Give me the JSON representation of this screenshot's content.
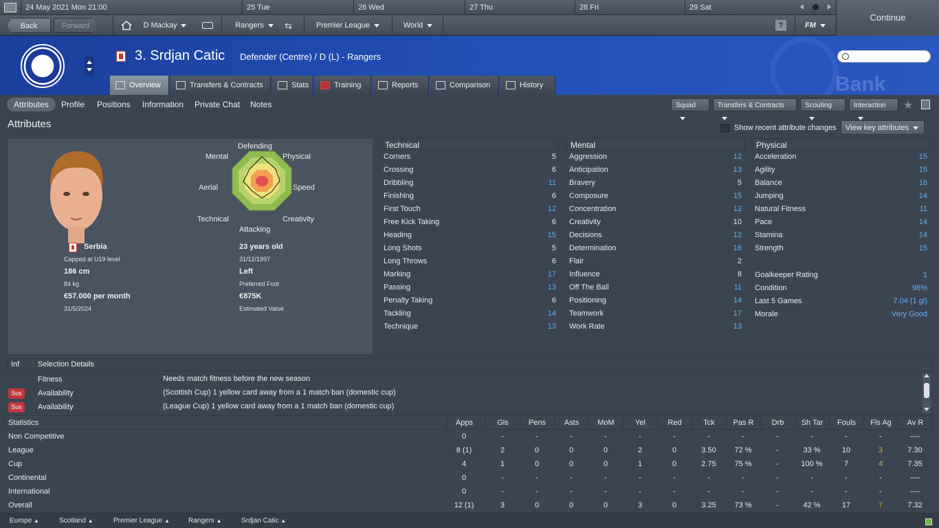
{
  "datebar": {
    "current": "24 May 2021 Mon 21:00",
    "days": [
      "25  Tue",
      "26  Wed",
      "27  Thu",
      "28  Fri",
      "29  Sat"
    ],
    "continue": "Continue"
  },
  "nav": {
    "back": "Back",
    "forward": "Forward",
    "manager": "D Mackay",
    "club": "Rangers",
    "league": "Premier League",
    "world": "World",
    "fm": "FM"
  },
  "player": {
    "title": "3. Srdjan Catic",
    "subtitle": "Defender (Centre) / D (L) - Rangers"
  },
  "tabs": [
    "Overview",
    "Transfers & Contracts",
    "Stats",
    "Training",
    "Reports",
    "Comparison",
    "History"
  ],
  "subtabs": [
    "Attributes",
    "Profile",
    "Positions",
    "Information",
    "Private Chat",
    "Notes"
  ],
  "toolbar": [
    "Squad",
    "Transfers & Contracts",
    "Scouting",
    "Interaction"
  ],
  "attributes_title": "Attributes",
  "show_recent": "Show recent attribute changes",
  "view_key": "View key attributes",
  "radar": {
    "labels": [
      "Defending",
      "Physical",
      "Speed",
      "Creativity",
      "Attacking",
      "Technical",
      "Aerial",
      "Mental"
    ]
  },
  "bio": {
    "nation": "Serbia",
    "caps": "Capped at U19 level",
    "height": "186 cm",
    "weight": "84 kg",
    "wage": "€57.000 per month",
    "contract_end": "31/5/2024",
    "age": "23 years old",
    "dob": "31/12/1997",
    "foot": "Left",
    "foot_label": "Preferred Foot",
    "value": "€875K",
    "value_label": "Estimated Value"
  },
  "technical": {
    "title": "Technical",
    "items": [
      {
        "name": "Corners",
        "value": "5",
        "hi": false
      },
      {
        "name": "Crossing",
        "value": "6",
        "hi": false
      },
      {
        "name": "Dribbling",
        "value": "11",
        "hi": true
      },
      {
        "name": "Finishing",
        "value": "6",
        "hi": false
      },
      {
        "name": "First Touch",
        "value": "12",
        "hi": true
      },
      {
        "name": "Free Kick Taking",
        "value": "6",
        "hi": false
      },
      {
        "name": "Heading",
        "value": "15",
        "hi": true
      },
      {
        "name": "Long Shots",
        "value": "5",
        "hi": false
      },
      {
        "name": "Long Throws",
        "value": "6",
        "hi": false
      },
      {
        "name": "Marking",
        "value": "17",
        "hi": true
      },
      {
        "name": "Passing",
        "value": "13",
        "hi": true
      },
      {
        "name": "Penalty Taking",
        "value": "6",
        "hi": false
      },
      {
        "name": "Tackling",
        "value": "14",
        "hi": true
      },
      {
        "name": "Technique",
        "value": "13",
        "hi": true
      }
    ]
  },
  "mental": {
    "title": "Mental",
    "items": [
      {
        "name": "Aggression",
        "value": "12",
        "hi": true
      },
      {
        "name": "Anticipation",
        "value": "13",
        "hi": true
      },
      {
        "name": "Bravery",
        "value": "5",
        "hi": false
      },
      {
        "name": "Composure",
        "value": "15",
        "hi": true
      },
      {
        "name": "Concentration",
        "value": "12",
        "hi": true
      },
      {
        "name": "Creativity",
        "value": "10",
        "hi": false
      },
      {
        "name": "Decisions",
        "value": "12",
        "hi": true
      },
      {
        "name": "Determination",
        "value": "16",
        "hi": true
      },
      {
        "name": "Flair",
        "value": "2",
        "hi": false
      },
      {
        "name": "Influence",
        "value": "8",
        "hi": false
      },
      {
        "name": "Off The Ball",
        "value": "11",
        "hi": true
      },
      {
        "name": "Positioning",
        "value": "14",
        "hi": true
      },
      {
        "name": "Teamwork",
        "value": "17",
        "hi": true
      },
      {
        "name": "Work Rate",
        "value": "13",
        "hi": true
      }
    ]
  },
  "physical": {
    "title": "Physical",
    "items": [
      {
        "name": "Acceleration",
        "value": "15",
        "hi": true
      },
      {
        "name": "Agility",
        "value": "15",
        "hi": true
      },
      {
        "name": "Balance",
        "value": "16",
        "hi": true
      },
      {
        "name": "Jumping",
        "value": "14",
        "hi": true
      },
      {
        "name": "Natural Fitness",
        "value": "11",
        "hi": true
      },
      {
        "name": "Pace",
        "value": "14",
        "hi": true
      },
      {
        "name": "Stamina",
        "value": "14",
        "hi": true
      },
      {
        "name": "Strength",
        "value": "15",
        "hi": true
      }
    ],
    "extra": [
      {
        "name": "Goalkeeper Rating",
        "value": "1"
      },
      {
        "name": "Condition",
        "value": "98%"
      },
      {
        "name": "Last 5 Games",
        "value": "7.04 (1 gl)"
      },
      {
        "name": "Morale",
        "value": "Very Good"
      }
    ]
  },
  "selection": {
    "col1": "Inf",
    "col2": "Selection Details",
    "rows": [
      {
        "badge": "",
        "type": "Fitness",
        "detail": "Needs match fitness before the new season"
      },
      {
        "badge": "Sus",
        "type": "Availability",
        "detail": "(Scottish Cup) 1 yellow card away from a 1 match ban (domestic cup)"
      },
      {
        "badge": "Sus",
        "type": "Availability",
        "detail": "(League Cup) 1 yellow card away from a 1 match ban (domestic cup)"
      }
    ]
  },
  "stats": {
    "headers": [
      "Statistics",
      "Apps",
      "Gls",
      "Pens",
      "Asts",
      "MoM",
      "Yel",
      "Red",
      "Tck",
      "Pas R",
      "Drb",
      "Sh Tar",
      "Fouls",
      "Fls Ag",
      "Av R"
    ],
    "rows": [
      [
        "Non Competitive",
        "0",
        "-",
        "-",
        "-",
        "-",
        "-",
        "-",
        "-",
        "-",
        "-",
        "-",
        "-",
        "-",
        "----"
      ],
      [
        "League",
        "8 (1)",
        "2",
        "0",
        "0",
        "0",
        "2",
        "0",
        "3.50",
        "72 %",
        "-",
        "33 %",
        "10",
        "3",
        "7.30"
      ],
      [
        "Cup",
        "4",
        "1",
        "0",
        "0",
        "0",
        "1",
        "0",
        "2.75",
        "75 %",
        "-",
        "100 %",
        "7",
        "4",
        "7.35"
      ],
      [
        "Continental",
        "0",
        "-",
        "-",
        "-",
        "-",
        "-",
        "-",
        "-",
        "-",
        "-",
        "-",
        "-",
        "-",
        "----"
      ],
      [
        "International",
        "0",
        "-",
        "-",
        "-",
        "-",
        "-",
        "-",
        "-",
        "-",
        "-",
        "-",
        "-",
        "-",
        "----"
      ],
      [
        "Overall",
        "12 (1)",
        "3",
        "0",
        "0",
        "0",
        "3",
        "0",
        "3.25",
        "73 %",
        "-",
        "42 %",
        "17",
        "7",
        "7.32"
      ]
    ]
  },
  "breadcrumbs": [
    "Europe",
    "Scotland",
    "Premier League",
    "Rangers",
    "Srdjan Catic"
  ]
}
